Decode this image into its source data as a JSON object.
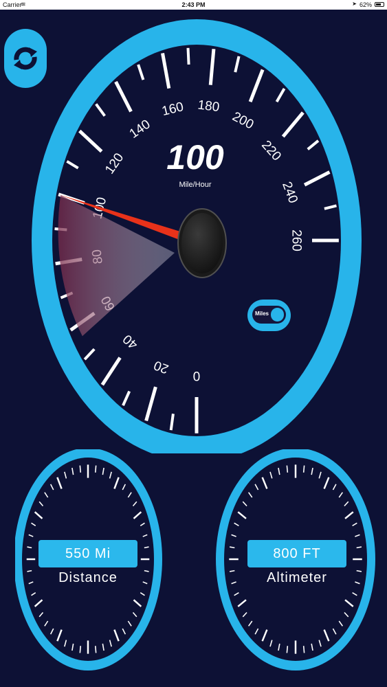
{
  "status_bar": {
    "carrier": "Carrier",
    "time": "2:43 PM",
    "battery": "62%"
  },
  "colors": {
    "background": "#0d1135",
    "accent": "#28b4ea",
    "needle": "#e8321a",
    "tick": "#ffffff"
  },
  "refresh_button": {
    "icon": "refresh-icon"
  },
  "speedometer": {
    "speed_value": "100",
    "unit_label": "Mile/Hour",
    "scale_labels": [
      "0",
      "20",
      "40",
      "60",
      "80",
      "100",
      "120",
      "140",
      "160",
      "180",
      "200",
      "220",
      "240",
      "260"
    ],
    "scale_min": 0,
    "scale_max": 260,
    "needle_value": 100
  },
  "unit_toggle": {
    "label": "Miles",
    "on": true
  },
  "distance_gauge": {
    "value": "550 Mi",
    "label": "Distance"
  },
  "altimeter_gauge": {
    "value": "800 FT",
    "label": "Altimeter"
  }
}
